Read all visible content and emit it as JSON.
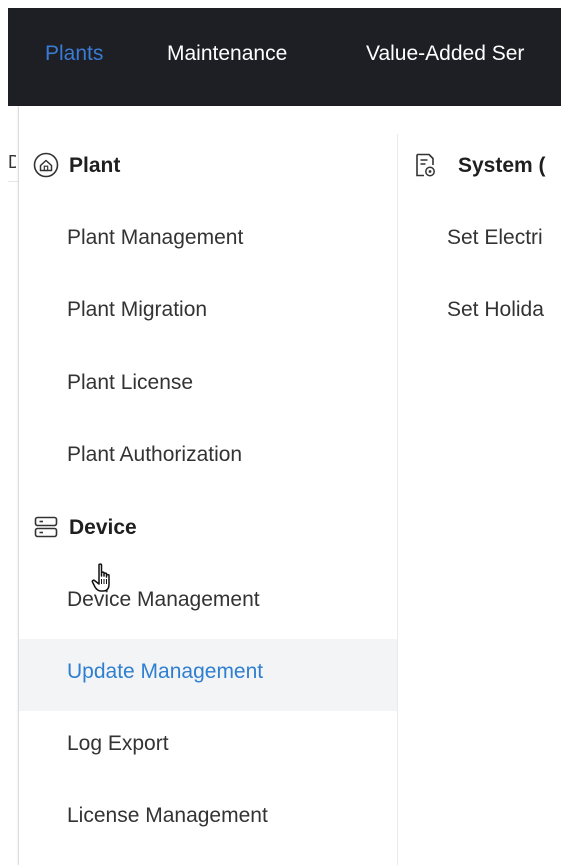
{
  "topnav": {
    "items": [
      {
        "label": "Plants",
        "active": true
      },
      {
        "label": "Maintenance",
        "active": false
      },
      {
        "label": "Value-Added Ser",
        "active": false
      }
    ]
  },
  "background_peek": {
    "char": "D"
  },
  "menu": {
    "plant_section": {
      "title": "Plant",
      "icon": "house-icon",
      "items": [
        "Plant Management",
        "Plant Migration",
        "Plant License",
        "Plant Authorization"
      ]
    },
    "device_section": {
      "title": "Device",
      "icon": "server-icon",
      "items": [
        "Device Management",
        "Update Management",
        "Log Export",
        "License Management"
      ],
      "hovered_index": 1
    },
    "system_section": {
      "title": "System (",
      "icon": "document-settings-icon",
      "items": [
        "Set Electri",
        "Set Holida"
      ]
    }
  },
  "colors": {
    "topbar_bg": "#1e1f24",
    "active_nav": "#3a7bd5",
    "hover_text": "#2f7fd1",
    "hover_bg": "#f3f4f6"
  }
}
